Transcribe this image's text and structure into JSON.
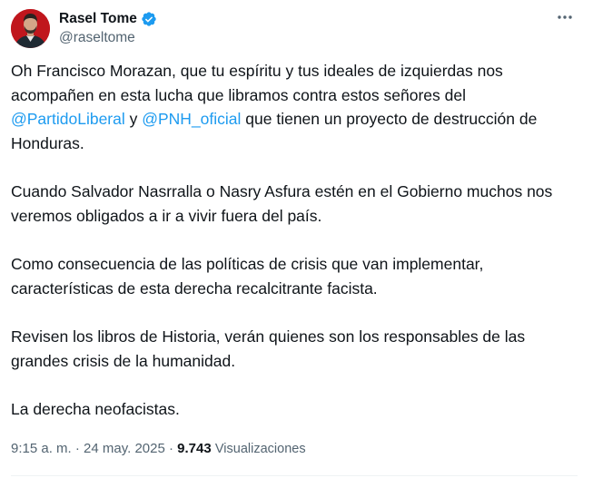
{
  "author": {
    "name": "Rasel Tome",
    "handle": "@raseltome",
    "verified": true
  },
  "more_icon": "more-horizontal-icon",
  "body": {
    "p1": {
      "text_a": "Oh  Francisco Morazan, que tu espíritu y tus ideales de izquierdas nos acompañen en esta lucha que libramos contra estos señores del ",
      "mention_1": "@PartidoLiberal",
      "text_b": "  y ",
      "mention_2": "@PNH_oficial",
      "text_c": " que tienen un proyecto de destrucción de Honduras."
    },
    "p2": "Cuando Salvador Nasrralla o Nasry Asfura estén en el Gobierno muchos nos veremos obligados a ir a vivir fuera del país.",
    "p3": "Como consecuencia de las políticas de crisis que van implementar, características de esta derecha recalcitrante facista.",
    "p4": "Revisen los libros de Historia, verán quienes son los responsables de las grandes crisis de la humanidad.",
    "p5": "La derecha neofacistas."
  },
  "meta": {
    "time": "9:15 a. m.",
    "sep1": " · ",
    "date": "24 may. 2025",
    "sep2": " · ",
    "views_count": "9.743",
    "views_label": "Visualizaciones"
  },
  "colors": {
    "link": "#1d9bf0",
    "verified": "#1d9bf0",
    "secondary_text": "#536471"
  }
}
